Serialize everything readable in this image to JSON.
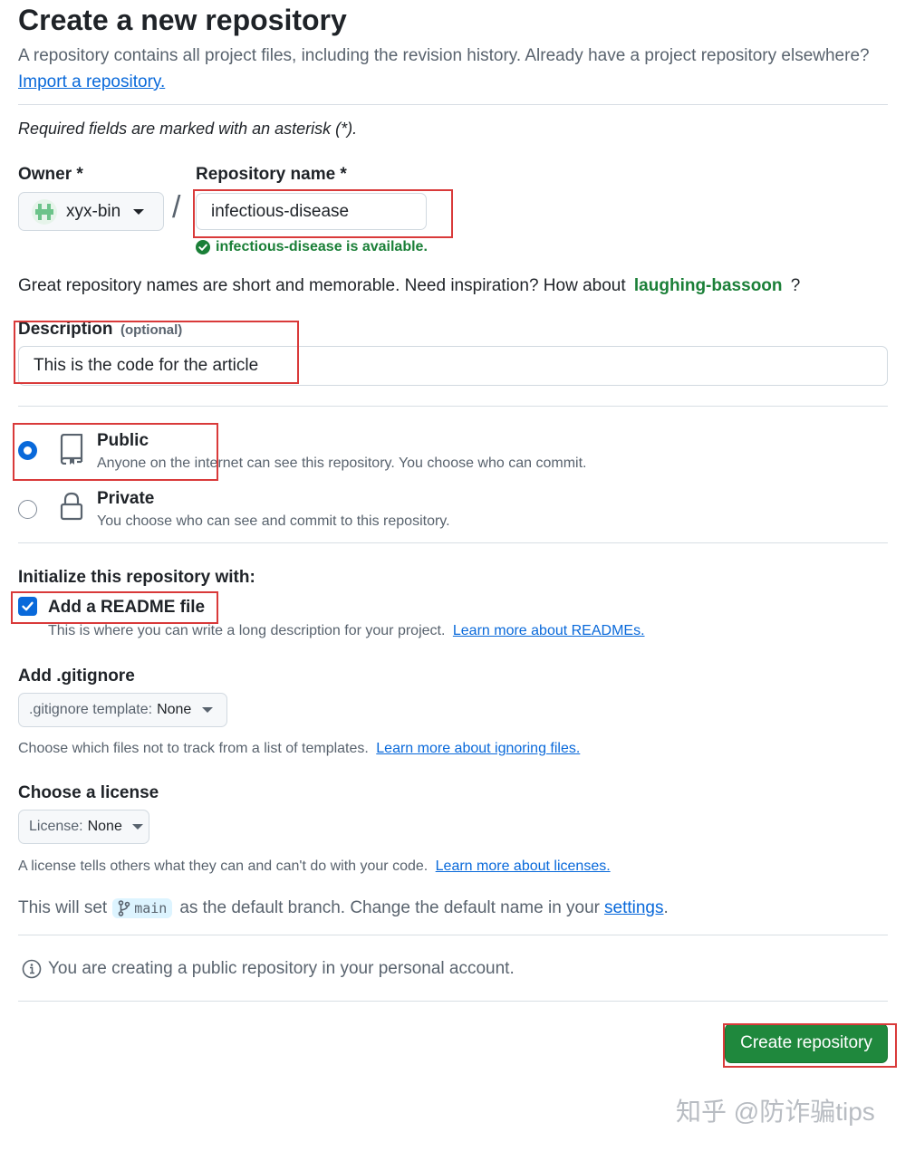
{
  "page": {
    "title": "Create a new repository",
    "intro": "A repository contains all project files, including the revision history. Already have a project repository elsewhere?",
    "import_link": "Import a repository.",
    "required_note": "Required fields are marked with an asterisk (*)."
  },
  "owner": {
    "label": "Owner *",
    "value": "xyx-bin"
  },
  "separator": "/",
  "repo_name": {
    "label": "Repository name *",
    "value": "infectious-disease",
    "available_msg": "infectious-disease is available."
  },
  "suggestion": {
    "text": "Great repository names are short and memorable. Need inspiration? How about",
    "name": "laughing-bassoon",
    "suffix": "?"
  },
  "description": {
    "label": "Description",
    "optional": "(optional)",
    "value": "This is the code for the article"
  },
  "visibility": {
    "public": {
      "title": "Public",
      "desc": "Anyone on the internet can see this repository. You choose who can commit.",
      "selected": true
    },
    "private": {
      "title": "Private",
      "desc": "You choose who can see and commit to this repository.",
      "selected": false
    }
  },
  "initialize": {
    "heading": "Initialize this repository with:",
    "readme_label": "Add a README file",
    "readme_checked": true,
    "readme_desc": "This is where you can write a long description for your project.",
    "readme_link": "Learn more about READMEs."
  },
  "gitignore": {
    "heading": "Add .gitignore",
    "select_prefix": ".gitignore template:",
    "select_value": "None",
    "desc": "Choose which files not to track from a list of templates.",
    "link": "Learn more about ignoring files."
  },
  "license": {
    "heading": "Choose a license",
    "select_prefix": "License:",
    "select_value": "None",
    "desc": "A license tells others what they can and can't do with your code.",
    "link": "Learn more about licenses."
  },
  "branch": {
    "prefix": "This will set",
    "name": "main",
    "middle": "as the default branch. Change the default name in your",
    "link": "settings",
    "suffix": "."
  },
  "info_note": "You are creating a public repository in your personal account.",
  "create_button": "Create repository",
  "watermark": "知乎 @防诈骗tips",
  "colors": {
    "primary_green": "#1f883d",
    "link_blue": "#0969da",
    "success_green": "#1a7f37",
    "highlight_red": "#d93a3a"
  }
}
